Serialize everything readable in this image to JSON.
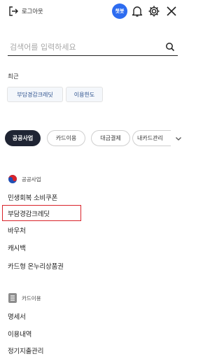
{
  "header": {
    "logout_label": "로그아웃",
    "chatbot_label": "챗봇"
  },
  "search": {
    "placeholder": "검색어를 입력하세요"
  },
  "recent": {
    "title": "최근",
    "items": [
      "부담경감크레딧",
      "이용한도"
    ]
  },
  "categories": {
    "items": [
      "공공사업",
      "카드이용",
      "대금결제",
      "내카드관리"
    ],
    "selected": "공공사업"
  },
  "sections": [
    {
      "title": "공공사업",
      "icon": "korea-taegeuk-icon",
      "items": [
        "민생회복 소비쿠폰",
        "부담경감크레딧",
        "바우처",
        "캐시백",
        "카드형 온누리상품권"
      ]
    },
    {
      "title": "카드이용",
      "icon": "document-list-icon",
      "items": [
        "명세서",
        "이용내역",
        "정기지출관리"
      ]
    }
  ],
  "colors": {
    "active_pill": "#1f2433",
    "chatbot": "#2d6cf0",
    "highlight_border": "#d9232a"
  }
}
